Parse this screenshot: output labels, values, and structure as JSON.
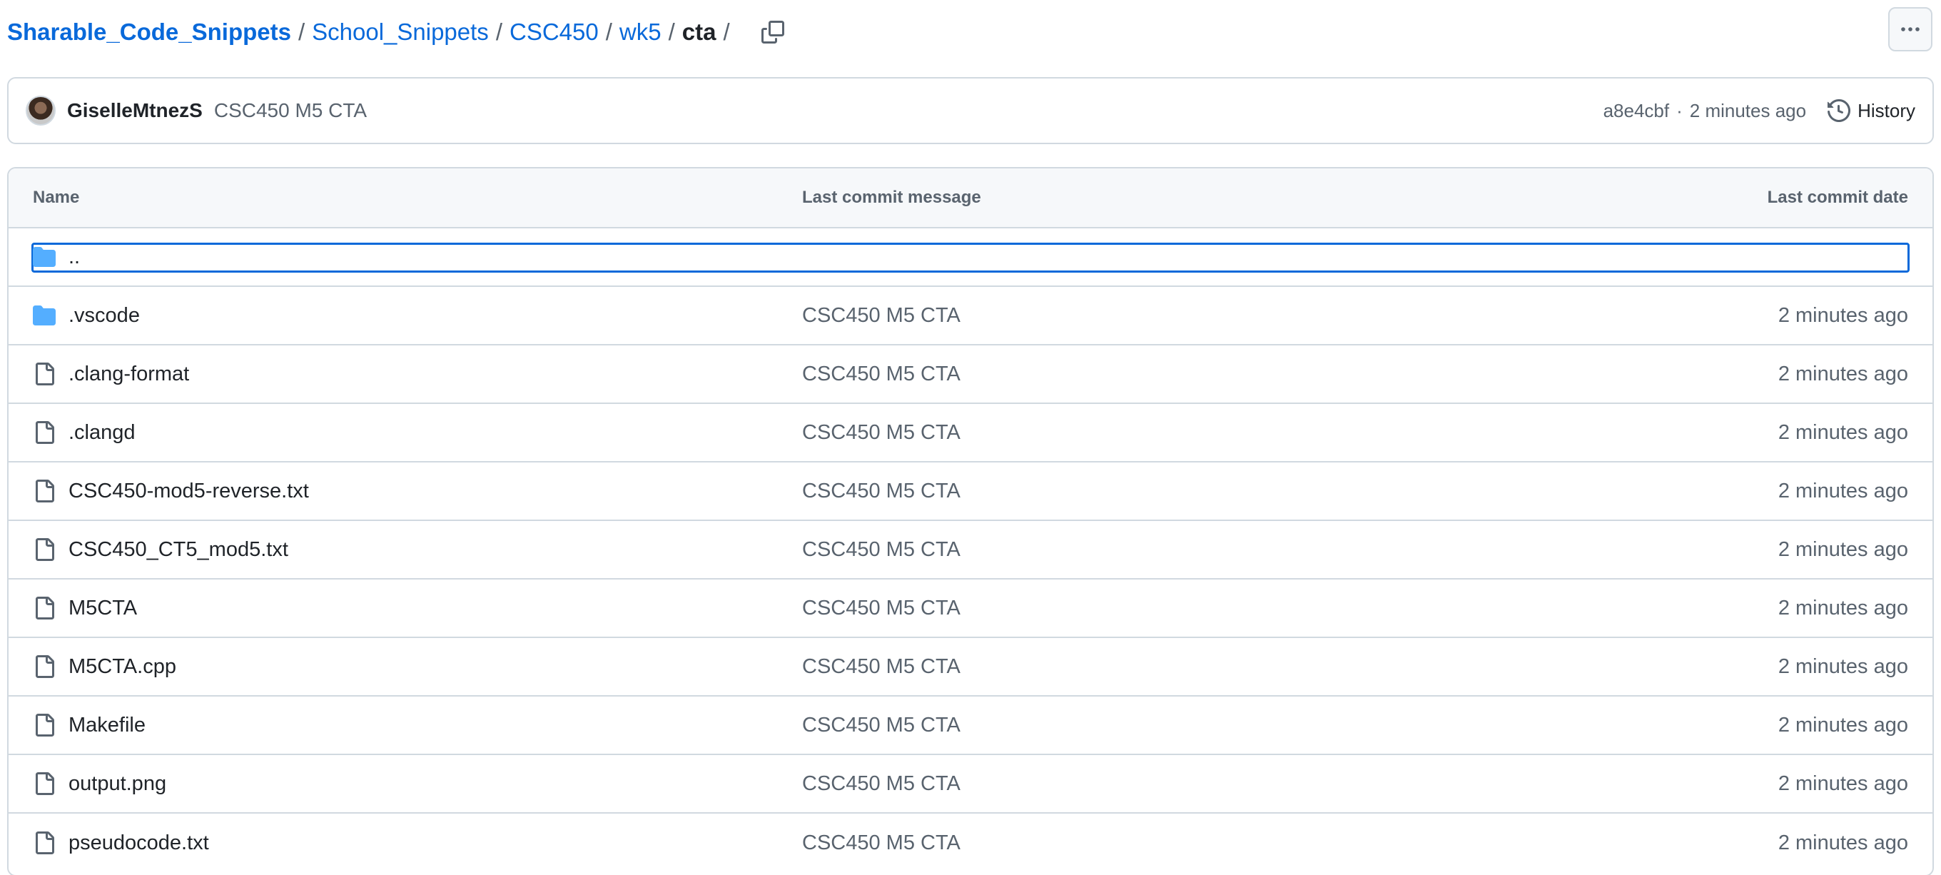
{
  "breadcrumb": {
    "items": [
      "Sharable_Code_Snippets",
      "School_Snippets",
      "CSC450",
      "wk5"
    ],
    "current": "cta",
    "separator": "/"
  },
  "icons": {
    "copy": "copy-icon",
    "more": "kebab-horizontal-icon",
    "history": "history-icon",
    "folder": "folder-icon",
    "file": "file-icon"
  },
  "colors": {
    "link": "#0969da",
    "folder": "#54aeff",
    "muted": "#59636e",
    "border": "#d1d9e0"
  },
  "commit": {
    "author": "GiselleMtnezS",
    "message": "CSC450 M5 CTA",
    "sha": "a8e4cbf",
    "dot": "·",
    "time": "2 minutes ago",
    "history_label": "History"
  },
  "table": {
    "headers": {
      "name": "Name",
      "message": "Last commit message",
      "date": "Last commit date"
    },
    "parent_label": "..",
    "rows": [
      {
        "name": ".vscode",
        "type": "folder",
        "message": "CSC450 M5 CTA",
        "date": "2 minutes ago"
      },
      {
        "name": ".clang-format",
        "type": "file",
        "message": "CSC450 M5 CTA",
        "date": "2 minutes ago"
      },
      {
        "name": ".clangd",
        "type": "file",
        "message": "CSC450 M5 CTA",
        "date": "2 minutes ago"
      },
      {
        "name": "CSC450-mod5-reverse.txt",
        "type": "file",
        "message": "CSC450 M5 CTA",
        "date": "2 minutes ago"
      },
      {
        "name": "CSC450_CT5_mod5.txt",
        "type": "file",
        "message": "CSC450 M5 CTA",
        "date": "2 minutes ago"
      },
      {
        "name": "M5CTA",
        "type": "file",
        "message": "CSC450 M5 CTA",
        "date": "2 minutes ago"
      },
      {
        "name": "M5CTA.cpp",
        "type": "file",
        "message": "CSC450 M5 CTA",
        "date": "2 minutes ago"
      },
      {
        "name": "Makefile",
        "type": "file",
        "message": "CSC450 M5 CTA",
        "date": "2 minutes ago"
      },
      {
        "name": "output.png",
        "type": "file",
        "message": "CSC450 M5 CTA",
        "date": "2 minutes ago"
      },
      {
        "name": "pseudocode.txt",
        "type": "file",
        "message": "CSC450 M5 CTA",
        "date": "2 minutes ago"
      }
    ]
  }
}
